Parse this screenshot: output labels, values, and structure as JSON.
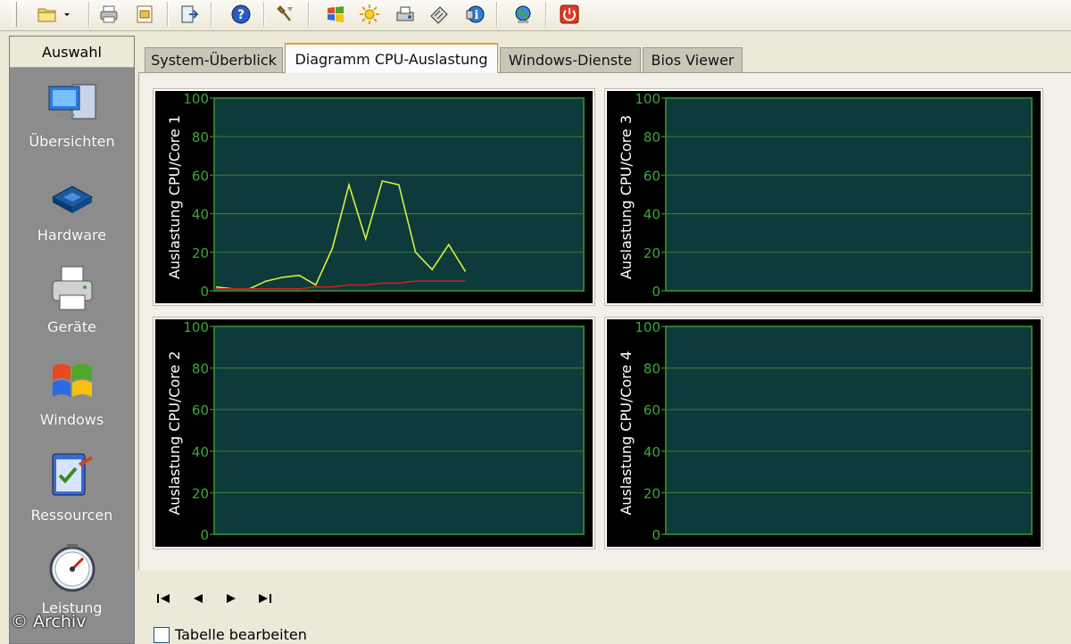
{
  "toolbar": {
    "buttons": [
      "folder-icon",
      "chevron-down-icon",
      "printer-icon",
      "print-preview-icon",
      "export-icon",
      "help-icon",
      "tools-icon",
      "windows-logo-icon",
      "sun-icon",
      "scanner-icon",
      "keyboard-icon",
      "info-icon",
      "globe-icon",
      "power-icon"
    ]
  },
  "sidebar": {
    "header": "Auswahl",
    "items": [
      {
        "label": "Übersichten",
        "icon": "computer-icon"
      },
      {
        "label": "Hardware",
        "icon": "chip-icon"
      },
      {
        "label": "Geräte",
        "icon": "printer-icon"
      },
      {
        "label": "Windows",
        "icon": "windows-logo-icon"
      },
      {
        "label": "Ressourcen",
        "icon": "clipboard-check-icon"
      },
      {
        "label": "Leistung",
        "icon": "gauge-icon"
      }
    ]
  },
  "tabs": [
    {
      "label": "System-Überblick",
      "active": false
    },
    {
      "label": "Diagramm CPU-Auslastung",
      "active": true
    },
    {
      "label": "Windows-Dienste",
      "active": false
    },
    {
      "label": "Bios Viewer",
      "active": false
    }
  ],
  "navigation": {
    "buttons": [
      "first-icon",
      "previous-icon",
      "next-icon",
      "last-icon"
    ]
  },
  "table_edit": {
    "label": "Tabelle bearbeiten",
    "checked": false
  },
  "watermark": "© Archiv",
  "colors": {
    "plot_bg": "#0d3a3a",
    "grid": "#2f7a2f",
    "axis_text": "#3aa83a",
    "series_total": "#d8f040",
    "series_kernel": "#d02020"
  },
  "chart_data": [
    {
      "type": "line",
      "ylabel": "Auslastung CPU/Core 1",
      "ylim": [
        0,
        100
      ],
      "yticks": [
        "0",
        "20",
        "40",
        "60",
        "80",
        "100"
      ],
      "series": [
        {
          "values": [
            2,
            1,
            1,
            5,
            7,
            8,
            3,
            22,
            55,
            27,
            57,
            55,
            20,
            11,
            24,
            10
          ]
        },
        {
          "values": [
            1,
            1,
            1,
            1,
            1,
            1,
            2,
            2,
            3,
            3,
            4,
            4,
            5,
            5,
            5,
            5
          ]
        }
      ]
    },
    {
      "type": "line",
      "ylabel": "Auslastung CPU/Core 3",
      "ylim": [
        0,
        100
      ],
      "yticks": [
        "0",
        "20",
        "40",
        "60",
        "80",
        "100"
      ],
      "series": []
    },
    {
      "type": "line",
      "ylabel": "Auslastung CPU/Core 2",
      "ylim": [
        0,
        100
      ],
      "yticks": [
        "0",
        "20",
        "40",
        "60",
        "80",
        "100"
      ],
      "series": []
    },
    {
      "type": "line",
      "ylabel": "Auslastung CPU/Core 4",
      "ylim": [
        0,
        100
      ],
      "yticks": [
        "0",
        "20",
        "40",
        "60",
        "80",
        "100"
      ],
      "series": []
    }
  ]
}
